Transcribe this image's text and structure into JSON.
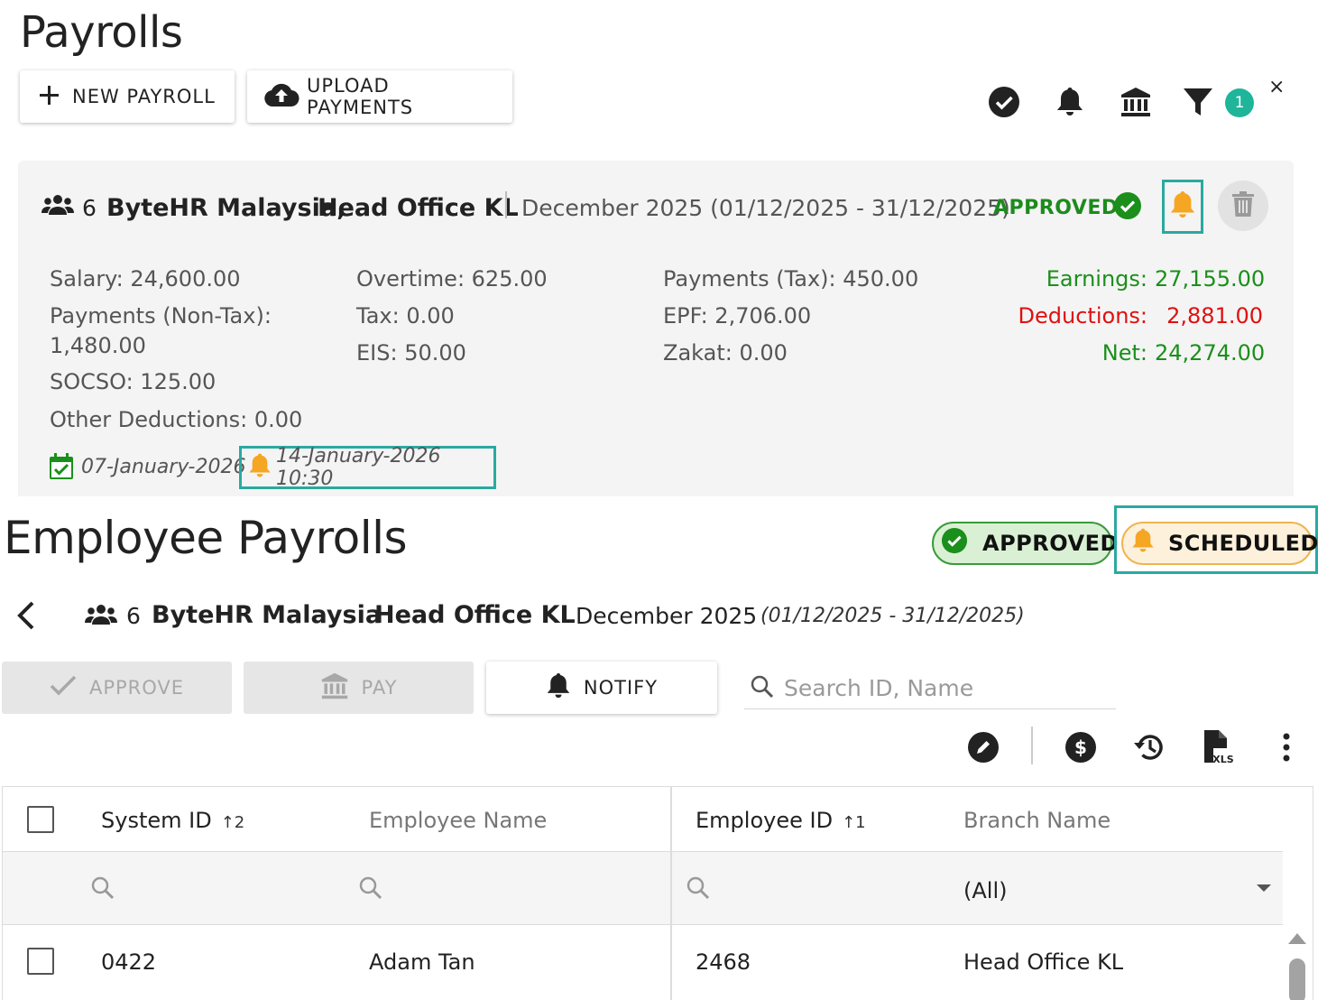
{
  "page": {
    "title": "Payrolls"
  },
  "toolbar": {
    "new_payroll": "NEW PAYROLL",
    "upload_payments": "UPLOAD PAYMENTS",
    "filter_count": "1",
    "close": "×"
  },
  "card": {
    "employee_count": "6",
    "company": "ByteHR Malaysia,",
    "branch": "Head Office KL",
    "period": "December 2025  (01/12/2025 - 31/12/2025)",
    "status": "APPROVED",
    "figures": {
      "salary": "Salary: 24,600.00",
      "payments_nontax": "Payments (Non-Tax):",
      "payments_nontax_value": "1,480.00",
      "socso": "SOCSO: 125.00",
      "other_deductions": "Other Deductions: 0.00",
      "overtime": "Overtime: 625.00",
      "tax": "Tax: 0.00",
      "eis": "EIS: 50.00",
      "payments_tax": "Payments (Tax): 450.00",
      "epf": "EPF: 2,706.00",
      "zakat": "Zakat: 0.00"
    },
    "summary": {
      "earnings_label": "Earnings:",
      "earnings_value": "27,155.00",
      "deductions_label": "Deductions:",
      "deductions_value": "2,881.00",
      "net_label": "Net:",
      "net_value": "24,274.00"
    },
    "created_date": "07-January-2026",
    "scheduled_date": "14-January-2026 10:30"
  },
  "employee_payrolls": {
    "title": "Employee Payrolls",
    "status_approved": "APPROVED",
    "status_scheduled": "SCHEDULED",
    "employee_count": "6",
    "company": "ByteHR Malaysia",
    "branch": "Head Office KL",
    "month": "December 2025",
    "range": "(01/12/2025 - 31/12/2025)",
    "actions": {
      "approve": "APPROVE",
      "pay": "PAY",
      "notify": "NOTIFY"
    },
    "search": {
      "placeholder": "Search ID, Name",
      "value": ""
    }
  },
  "grid": {
    "columns": [
      {
        "label": "System ID",
        "sort": "↑2"
      },
      {
        "label": "Employee Name",
        "sort": ""
      },
      {
        "label": "Employee ID",
        "sort": "↑1"
      },
      {
        "label": "Branch Name",
        "sort": ""
      }
    ],
    "branch_filter": "(All)",
    "rows": [
      {
        "system_id": "0422",
        "employee_name": "Adam Tan",
        "employee_id": "2468",
        "branch_name": "Head Office KL"
      }
    ]
  },
  "colors": {
    "accent_teal": "#2aa9a0",
    "approved_green": "#1b8f1b",
    "deduction_red": "#e01010",
    "bell_orange": "#f5a623",
    "badge_teal": "#1fb59b"
  }
}
